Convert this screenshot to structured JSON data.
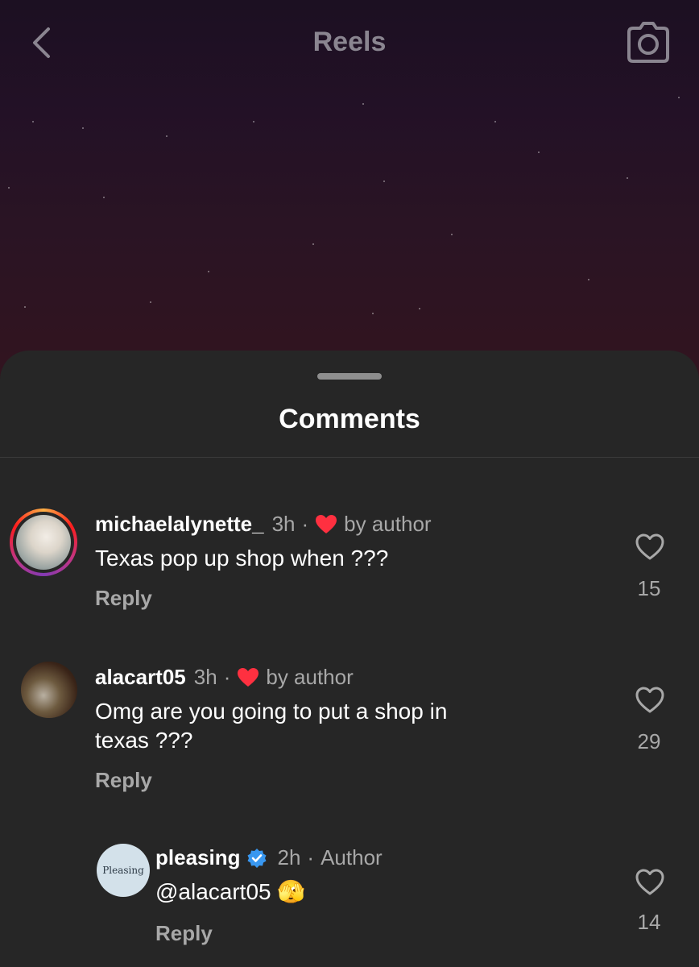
{
  "header": {
    "title": "Reels",
    "back_icon": "chevron-left-icon",
    "camera_icon": "camera-icon"
  },
  "sheet": {
    "title": "Comments"
  },
  "comments": [
    {
      "username": "michaelalynette_",
      "time": "3h",
      "separator": "·",
      "liked_label": "by author",
      "text": "Texas pop up shop when ???",
      "reply_label": "Reply",
      "like_count": "15"
    },
    {
      "username": "alacart05",
      "time": "3h",
      "separator": "·",
      "liked_label": "by author",
      "text_line1": "Omg are you going to put a shop in",
      "text_line2": "texas ???",
      "reply_label": "Reply",
      "like_count": "29"
    },
    {
      "username": "pleasing",
      "time": "2h",
      "separator": "·",
      "author_label": "Author",
      "avatar_text": "Pleasing",
      "text": "@alacart05 🫣",
      "reply_label": "Reply",
      "like_count": "14"
    }
  ],
  "colors": {
    "heart_red": "#ff3040",
    "verified_blue": "#3897f0",
    "sheet_bg": "#262626"
  }
}
